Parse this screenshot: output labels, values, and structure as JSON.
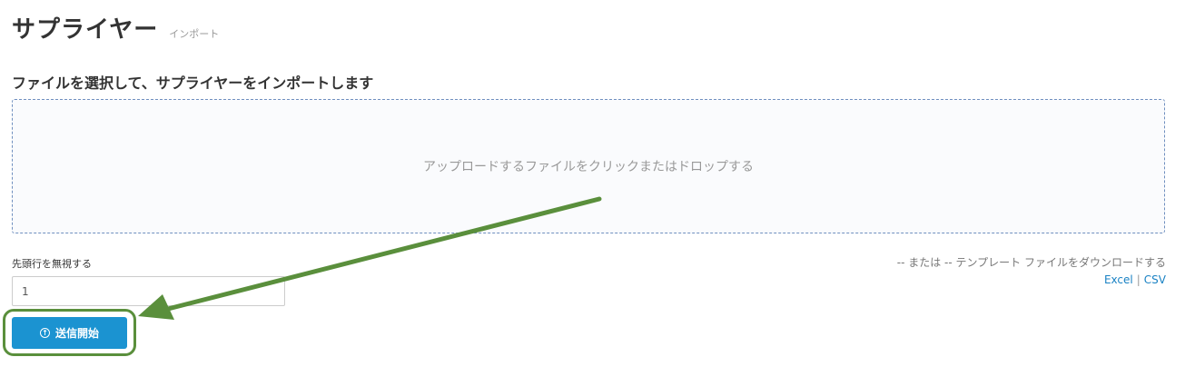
{
  "header": {
    "title": "サプライヤー",
    "subtitle": "インポート"
  },
  "import_section": {
    "title": "ファイルを選択して、サプライヤーをインポートします",
    "dropzone_text": "アップロードするファイルをクリックまたはドロップする"
  },
  "skip_rows": {
    "label": "先頭行を無視する",
    "value": "1"
  },
  "template": {
    "text": "-- または -- テンプレート ファイルをダウンロードする",
    "excel_label": "Excel",
    "separator": "|",
    "csv_label": "CSV"
  },
  "submit": {
    "label": "送信開始",
    "icon": "arrow-up-circle-icon"
  },
  "annotation": {
    "color": "#5a8f3c"
  }
}
